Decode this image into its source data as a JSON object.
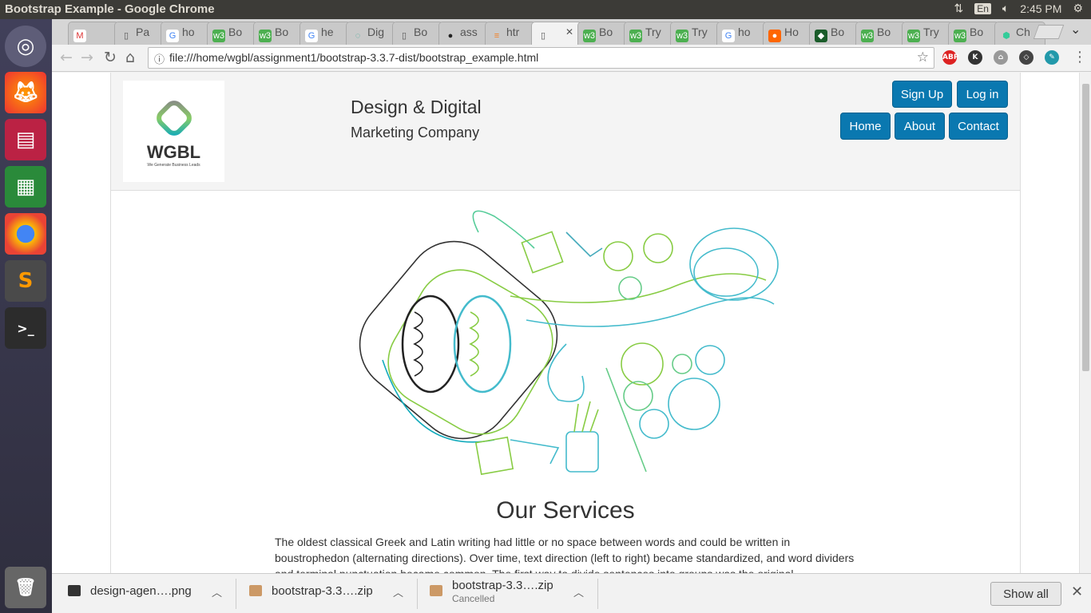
{
  "window": {
    "title": "Bootstrap Example - Google Chrome"
  },
  "tray": {
    "lang": "En",
    "time": "2:45 PM"
  },
  "tabs": [
    {
      "label": "",
      "icon": "gmail-icon",
      "fav": "M",
      "color": "#fff",
      "fg": "#d33"
    },
    {
      "label": "Pa",
      "icon": "page-icon",
      "fav": "▯",
      "color": "transparent",
      "fg": "#555"
    },
    {
      "label": "ho",
      "icon": "google-icon",
      "fav": "G",
      "color": "#fff",
      "fg": "#4285f4"
    },
    {
      "label": "Bo",
      "icon": "w3-icon",
      "fav": "w3",
      "color": "#4caf50",
      "fg": "#fff"
    },
    {
      "label": "Bo",
      "icon": "w3-icon",
      "fav": "w3",
      "color": "#4caf50",
      "fg": "#fff"
    },
    {
      "label": "he",
      "icon": "google-icon",
      "fav": "G",
      "color": "#fff",
      "fg": "#4285f4"
    },
    {
      "label": "Dig",
      "icon": "spinner-icon",
      "fav": "◌",
      "color": "transparent",
      "fg": "#4a9"
    },
    {
      "label": "Bo",
      "icon": "page-icon",
      "fav": "▯",
      "color": "transparent",
      "fg": "#555"
    },
    {
      "label": "ass",
      "icon": "github-icon",
      "fav": "●",
      "color": "transparent",
      "fg": "#222"
    },
    {
      "label": "htr",
      "icon": "stack-icon",
      "fav": "≡",
      "color": "transparent",
      "fg": "#f48024"
    },
    {
      "label": "",
      "icon": "page-icon",
      "fav": "▯",
      "color": "transparent",
      "fg": "#555"
    },
    {
      "label": "Bo",
      "icon": "w3-icon",
      "fav": "w3",
      "color": "#4caf50",
      "fg": "#fff"
    },
    {
      "label": "Try",
      "icon": "w3-icon",
      "fav": "w3",
      "color": "#4caf50",
      "fg": "#fff"
    },
    {
      "label": "Try",
      "icon": "w3-icon",
      "fav": "w3",
      "color": "#4caf50",
      "fg": "#fff"
    },
    {
      "label": "ho",
      "icon": "google-icon",
      "fav": "G",
      "color": "#fff",
      "fg": "#4285f4"
    },
    {
      "label": "Ho",
      "icon": "orange-icon",
      "fav": "●",
      "color": "#f60",
      "fg": "#fff"
    },
    {
      "label": "Bo",
      "icon": "codepen-icon",
      "fav": "◆",
      "color": "#1a5c2a",
      "fg": "#fff"
    },
    {
      "label": "Bo",
      "icon": "w3-icon",
      "fav": "w3",
      "color": "#4caf50",
      "fg": "#fff"
    },
    {
      "label": "Try",
      "icon": "w3-icon",
      "fav": "w3",
      "color": "#4caf50",
      "fg": "#fff"
    },
    {
      "label": "Bo",
      "icon": "w3-icon",
      "fav": "w3",
      "color": "#4caf50",
      "fg": "#fff"
    },
    {
      "label": "Ch",
      "icon": "hex-icon",
      "fav": "⬢",
      "color": "transparent",
      "fg": "#3c9"
    }
  ],
  "address": {
    "url": "file:///home/wgbl/assignment1/bootstrap-3.3.7-dist/bootstrap_example.html"
  },
  "extensions": [
    {
      "name": "adblock-icon",
      "text": "ABP",
      "color": "#d22"
    },
    {
      "name": "k-icon",
      "text": "K",
      "color": "#333"
    },
    {
      "name": "extension-icon",
      "text": "⌂",
      "color": "#999"
    },
    {
      "name": "box-icon",
      "text": "◇",
      "color": "#444"
    },
    {
      "name": "clipboard-icon",
      "text": "✎",
      "color": "#29a"
    }
  ],
  "site": {
    "logo_word": "WGBL",
    "logo_tagline": "We Generate Business Leads",
    "brand_line1": "Design & Digital",
    "brand_line2": "Marketing Company",
    "sign_up": "Sign Up",
    "log_in": "Log in",
    "nav": {
      "home": "Home",
      "about": "About",
      "contact": "Contact"
    },
    "services_title": "Our Services",
    "services_text": "The oldest classical Greek and Latin writing had little or no space between words and could be written in boustrophedon (alternating directions). Over time, text direction (left to right) became standardized, and word dividers and terminal punctuation became common. The first way to divide sentences into groups was the original"
  },
  "downloads": [
    {
      "name": "design-agen….png",
      "status": "",
      "icon": "image-file-icon"
    },
    {
      "name": "bootstrap-3.3….zip",
      "status": "",
      "icon": "archive-icon"
    },
    {
      "name": "bootstrap-3.3….zip",
      "status": "Cancelled",
      "icon": "archive-icon"
    }
  ],
  "show_all": "Show all",
  "colors": {
    "accent": "#0a78b0"
  }
}
